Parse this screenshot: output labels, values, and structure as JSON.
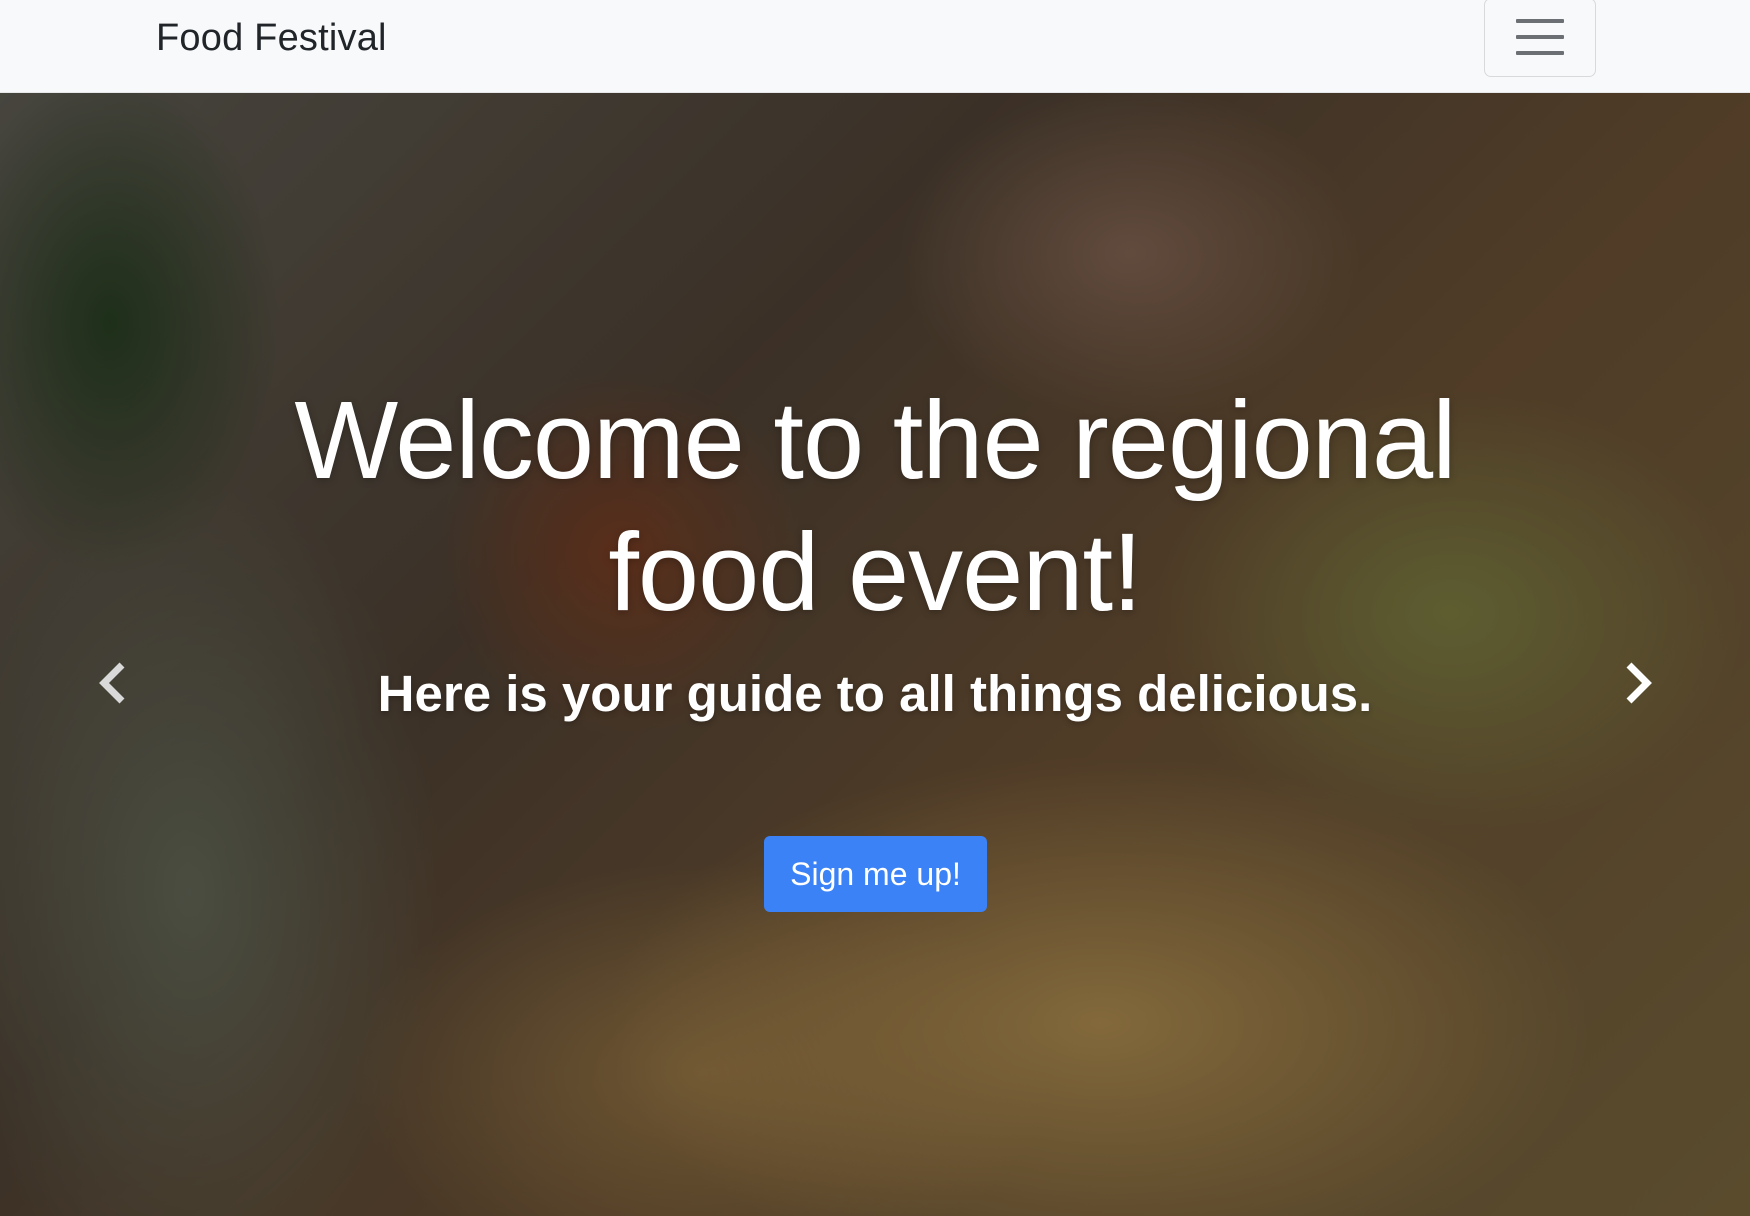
{
  "navbar": {
    "brand": "Food Festival",
    "toggler_icon": "hamburger-menu-icon"
  },
  "hero": {
    "headline_line1": "Welcome to the regional",
    "headline_line2": "food event!",
    "subheadline": "Here is your guide to all things delicious.",
    "cta_label": "Sign me up!",
    "prev_icon": "chevron-left-icon",
    "next_icon": "chevron-right-icon"
  },
  "colors": {
    "navbar_bg": "#f8f9fa",
    "cta_bg": "#3b82f6",
    "text_light": "#ffffff",
    "brand_text": "#212529"
  }
}
